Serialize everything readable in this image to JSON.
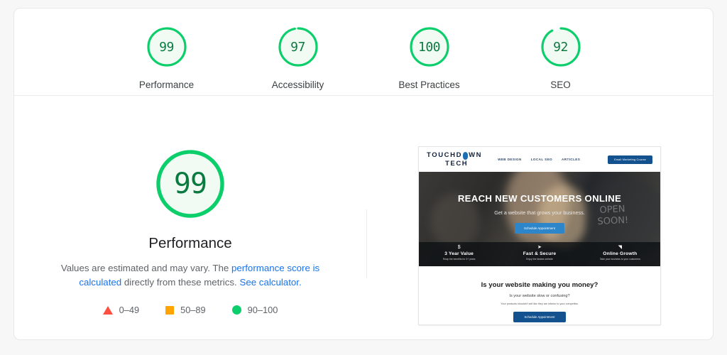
{
  "categories": [
    {
      "label": "Performance",
      "score": 99,
      "color": "#0cce6b"
    },
    {
      "label": "Accessibility",
      "score": 97,
      "color": "#0cce6b"
    },
    {
      "label": "Best Practices",
      "score": 100,
      "color": "#0cce6b"
    },
    {
      "label": "SEO",
      "score": 92,
      "color": "#0cce6b"
    }
  ],
  "detail": {
    "score": 99,
    "title": "Performance",
    "desc_prefix": "Values are estimated and may vary. The ",
    "desc_link1": "performance score is calculated",
    "desc_middle": " directly from these metrics. ",
    "desc_link2": "See calculator.",
    "legend": [
      {
        "icon": "triangle-icon",
        "range": "0–49",
        "color": "#ff4e42"
      },
      {
        "icon": "square-icon",
        "range": "50–89",
        "color": "#ffa400"
      },
      {
        "icon": "circle-icon",
        "range": "90–100",
        "color": "#0cce6b"
      }
    ]
  },
  "thumbnail": {
    "site": {
      "logo_line1": "TOUCHD",
      "logo_line1b": "WN",
      "logo_line2": "TECH",
      "nav": [
        "WEB DESIGN",
        "LOCAL SEO",
        "ARTICLES"
      ],
      "header_cta": "Email Marketing Course",
      "hero_heading": "REACH NEW CUSTOMERS ONLINE",
      "hero_sub": "Get a website that grows your business.",
      "hero_cta": "Schedule Appointment",
      "chalk_line1": "OPEN",
      "chalk_line2": "SOON!",
      "features": [
        {
          "icon": "dollar-icon",
          "glyph": "$",
          "title": "3 Year Value",
          "sub": "Reap the benefits for 3+ years"
        },
        {
          "icon": "rocket-icon",
          "glyph": "➤",
          "title": "Fast & Secure",
          "sub": "Enjoy the fastest website"
        },
        {
          "icon": "chart-icon",
          "glyph": "◥",
          "title": "Online Growth",
          "sub": "Take your business to your customers"
        }
      ],
      "lower_heading": "Is your website making you money?",
      "lower_sub1": "Is your website slow or confusing?",
      "lower_sub2": "Your products shouldn't sell like they are inferior to your competitor.",
      "lower_cta": "Schedule Appointment"
    }
  },
  "colors": {
    "pass": "#0cce6b",
    "average": "#ffa400",
    "fail": "#ff4e42",
    "link": "#1a73e8",
    "score_text": "#0b7a40",
    "gauge_fill": "#f1fbf4"
  }
}
